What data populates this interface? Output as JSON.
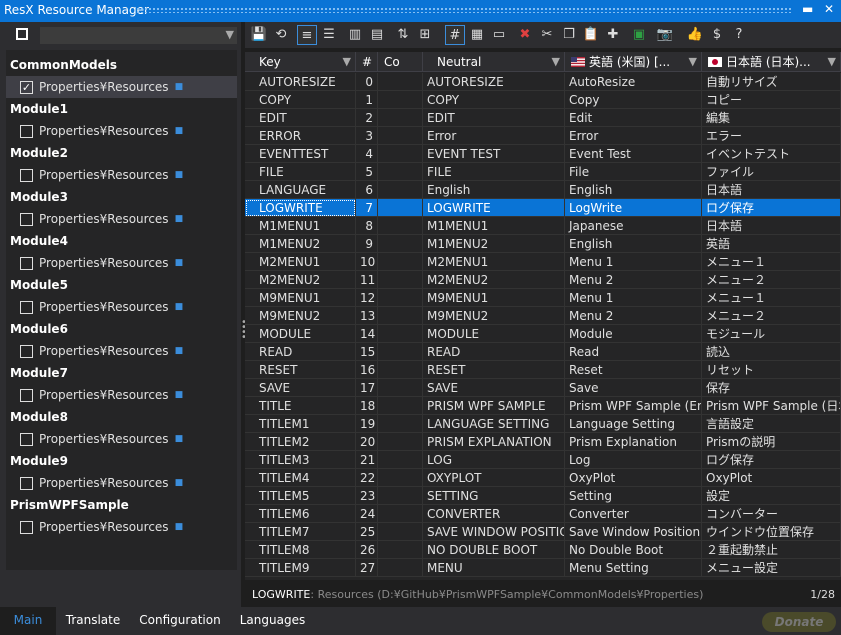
{
  "window": {
    "title": "ResX Resource Manager",
    "minimize": "▬",
    "close": "✕"
  },
  "sidebar": {
    "groups": [
      {
        "name": "CommonModels",
        "item": "Properties¥Resources",
        "checked": true
      },
      {
        "name": "Module1",
        "item": "Properties¥Resources",
        "checked": false
      },
      {
        "name": "Module2",
        "item": "Properties¥Resources",
        "checked": false
      },
      {
        "name": "Module3",
        "item": "Properties¥Resources",
        "checked": false
      },
      {
        "name": "Module4",
        "item": "Properties¥Resources",
        "checked": false
      },
      {
        "name": "Module5",
        "item": "Properties¥Resources",
        "checked": false
      },
      {
        "name": "Module6",
        "item": "Properties¥Resources",
        "checked": false
      },
      {
        "name": "Module7",
        "item": "Properties¥Resources",
        "checked": false
      },
      {
        "name": "Module8",
        "item": "Properties¥Resources",
        "checked": false
      },
      {
        "name": "Module9",
        "item": "Properties¥Resources",
        "checked": false
      },
      {
        "name": "PrismWPFSample",
        "item": "Properties¥Resources",
        "checked": false
      }
    ]
  },
  "grid": {
    "headers": {
      "key": "Key",
      "num": "#",
      "co": "Co",
      "neutral": "Neutral",
      "en": "英語 (米国) [...",
      "ja": "日本語 (日本)..."
    },
    "rows": [
      [
        "AUTORESIZE",
        "0",
        "AUTORESIZE",
        "AutoResize",
        "自動リサイズ"
      ],
      [
        "COPY",
        "1",
        "COPY",
        "Copy",
        "コピー"
      ],
      [
        "EDIT",
        "2",
        "EDIT",
        "Edit",
        "編集"
      ],
      [
        "ERROR",
        "3",
        "Error",
        "Error",
        "エラー"
      ],
      [
        "EVENTTEST",
        "4",
        "EVENT TEST",
        "Event Test",
        "イベントテスト"
      ],
      [
        "FILE",
        "5",
        "FILE",
        "File",
        "ファイル"
      ],
      [
        "LANGUAGE",
        "6",
        "English",
        "English",
        "日本語"
      ],
      [
        "LOGWRITE",
        "7",
        "LOGWRITE",
        "LogWrite",
        "ログ保存"
      ],
      [
        "M1MENU1",
        "8",
        "M1MENU1",
        "Japanese",
        "日本語"
      ],
      [
        "M1MENU2",
        "9",
        "M1MENU2",
        "English",
        "英語"
      ],
      [
        "M2MENU1",
        "10",
        "M2MENU1",
        "Menu 1",
        "メニュー１"
      ],
      [
        "M2MENU2",
        "11",
        "M2MENU2",
        "Menu 2",
        "メニュー２"
      ],
      [
        "M9MENU1",
        "12",
        "M9MENU1",
        "Menu 1",
        "メニュー１"
      ],
      [
        "M9MENU2",
        "13",
        "M9MENU2",
        "Menu 2",
        "メニュー２"
      ],
      [
        "MODULE",
        "14",
        "MODULE",
        "Module",
        "モジュール"
      ],
      [
        "READ",
        "15",
        "READ",
        "Read",
        "読込"
      ],
      [
        "RESET",
        "16",
        "RESET",
        "Reset",
        "リセット"
      ],
      [
        "SAVE",
        "17",
        "SAVE",
        "Save",
        "保存"
      ],
      [
        "TITLE",
        "18",
        "PRISM WPF SAMPLE",
        "Prism WPF Sample (English)",
        "Prism WPF Sample (日本語)"
      ],
      [
        "TITLEM1",
        "19",
        "LANGUAGE SETTING",
        "Language Setting",
        "言語設定"
      ],
      [
        "TITLEM2",
        "20",
        "PRISM EXPLANATION",
        "Prism Explanation",
        "Prismの説明"
      ],
      [
        "TITLEM3",
        "21",
        "LOG",
        "Log",
        "ログ保存"
      ],
      [
        "TITLEM4",
        "22",
        "OXYPLOT",
        "OxyPlot",
        "OxyPlot"
      ],
      [
        "TITLEM5",
        "23",
        "SETTING",
        "Setting",
        "設定"
      ],
      [
        "TITLEM6",
        "24",
        "CONVERTER",
        "Converter",
        "コンバーター"
      ],
      [
        "TITLEM7",
        "25",
        "SAVE WINDOW POSITION",
        "Save Window Position",
        "ウインドウ位置保存"
      ],
      [
        "TITLEM8",
        "26",
        "NO DOUBLE BOOT",
        "No Double Boot",
        "２重起動禁止"
      ],
      [
        "TITLEM9",
        "27",
        "MENU",
        "Menu  Setting",
        "メニュー設定"
      ]
    ],
    "selected_row": 7
  },
  "status": {
    "key": "LOGWRITE",
    "sep": ": ",
    "resources": "Resources",
    "path": " (D:¥GitHub¥PrismWPFSample¥CommonModels¥Properties)",
    "page": "1/28"
  },
  "tabs": [
    "Main",
    "Translate",
    "Configuration",
    "Languages"
  ],
  "active_tab": 0,
  "donate": "Donate",
  "colors": {
    "accent": "#0a74d6",
    "title_bar": "#0a74d6",
    "background": "#1e1e1e"
  }
}
